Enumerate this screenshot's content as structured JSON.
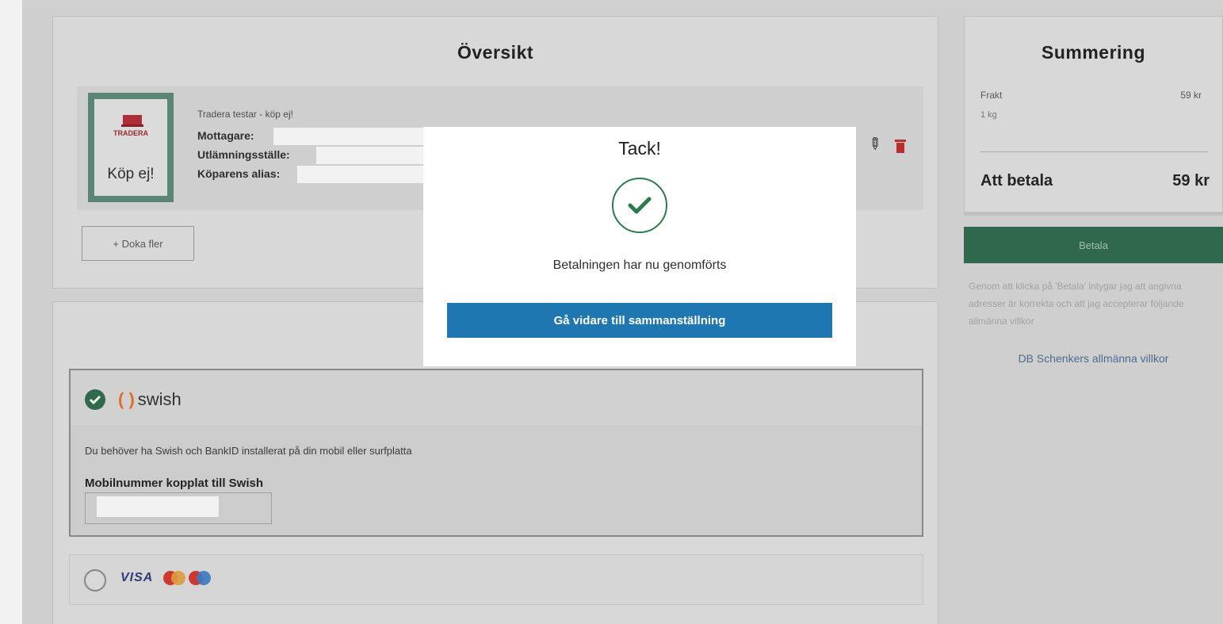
{
  "overview": {
    "title": "Översikt",
    "item": {
      "thumbnail_label": "Köp ej!",
      "thumbnail_brand": "TRADERA",
      "title": "Tradera testar - köp ej!",
      "recipient_label": "Mottagare:",
      "pickup_label": "Utlämningsställe:",
      "buyer_alias_label": "Köparens alias:"
    },
    "add_more_label": "+ Doka fler"
  },
  "payment": {
    "swish": {
      "brackets": "( )",
      "logo": "swish",
      "hint": "Du behöver ha Swish och BankID installerat på din mobil eller surfplatta",
      "mobile_label": "Mobilnummer kopplat till Swish"
    },
    "card": {
      "visa": "VISA"
    }
  },
  "summary": {
    "title": "Summering",
    "fee_label": "Frakt",
    "fee_value": "59 kr",
    "fee_sub": "1 kg",
    "total_label": "Att betala",
    "total_value": "59 kr",
    "pay_button": "Betala",
    "terms": "Genom att klicka på 'Betala' intygar jag att angivna adresser är korrekta och att jag accepterar följande allmänna villkor",
    "terms_link": "DB Schenkers allmänna villkor"
  },
  "modal": {
    "title": "Tack!",
    "message": "Betalningen har nu genomförts",
    "button": "Gå vidare till sammanställning"
  },
  "colors": {
    "brand_green": "#2d6a4d",
    "modal_button_blue": "#1f77b1",
    "delete_red": "#c62a2a"
  }
}
